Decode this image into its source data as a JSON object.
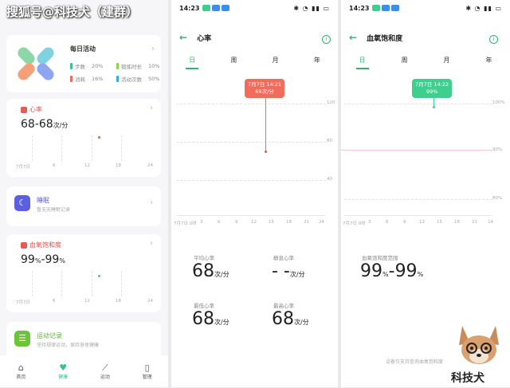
{
  "watermark": "搜狐号@科技犬（建群）",
  "panel2": {
    "time": "14:23",
    "title": "心率",
    "tabs": [
      "日",
      "周",
      "月",
      "年"
    ],
    "yticks": [
      "120",
      "80",
      "40"
    ],
    "xticks": [
      "7月7日 0时",
      "3",
      "6",
      "9",
      "12",
      "15",
      "18",
      "21",
      "24"
    ],
    "tooltip_date": "7月7日 14:21",
    "tooltip_value": "68次/分",
    "stats": [
      {
        "label": "平均心率",
        "value": "68",
        "unit": "次/分"
      },
      {
        "label": "静息心率",
        "value": "- -",
        "unit": "次/分"
      },
      {
        "label": "最低心率",
        "value": "68",
        "unit": "次/分"
      },
      {
        "label": "最高心率",
        "value": "68",
        "unit": "次/分"
      }
    ]
  },
  "panel3": {
    "time": "14:23",
    "title": "血氧饱和度",
    "tabs": [
      "日",
      "周",
      "月",
      "年"
    ],
    "yticks": [
      "100%",
      "90%",
      "80%"
    ],
    "xticks": [
      "7月7日 0时",
      "3",
      "6",
      "9",
      "12",
      "15",
      "18",
      "21",
      "24"
    ],
    "tooltip_date": "7月7日 14:22",
    "tooltip_value": "99%",
    "range_label": "血氧饱和度范围",
    "range_value": "99",
    "range_value2": "99",
    "range_unit": "%",
    "footnote": "设备仅支持查询血氧饱和度"
  },
  "panel1": {
    "daily": {
      "title": "每日活动",
      "stats": [
        {
          "label": "步数",
          "value": "20%",
          "color": "#3bbf9a"
        },
        {
          "label": "锻炼时长",
          "value": "10%",
          "color": "#8bd34a"
        },
        {
          "label": "消耗",
          "value": "16%",
          "color": "#f26b5b"
        },
        {
          "label": "活动次数",
          "value": "50%",
          "color": "#3aa6e6"
        }
      ]
    },
    "heart": {
      "title": "心率",
      "value": "68-68",
      "unit": "次/分",
      "xticks": [
        "7月7日",
        "6",
        "12",
        "18",
        "24"
      ]
    },
    "sleep": {
      "title": "睡眠",
      "subtitle": "暂无无睡眠记录"
    },
    "spo2": {
      "title": "血氧饱和度",
      "value_a": "99",
      "value_b": "99",
      "unit": "%",
      "xticks": [
        "7月7日",
        "6",
        "12",
        "18",
        "24"
      ]
    },
    "sport": {
      "title": "运动记录",
      "subtitle": "坚持规律运动，保持身体健康"
    },
    "nav": [
      {
        "label": "首页",
        "icon": "home-icon"
      },
      {
        "label": "健康",
        "icon": "heart-icon"
      },
      {
        "label": "运动",
        "icon": "run-icon"
      },
      {
        "label": "管理",
        "icon": "watch-icon"
      }
    ]
  },
  "mascot_text": "科技犬",
  "colors": {
    "accent": "#2bb673",
    "heart": "#f26b5b",
    "spo2": "#3ecf8e"
  }
}
